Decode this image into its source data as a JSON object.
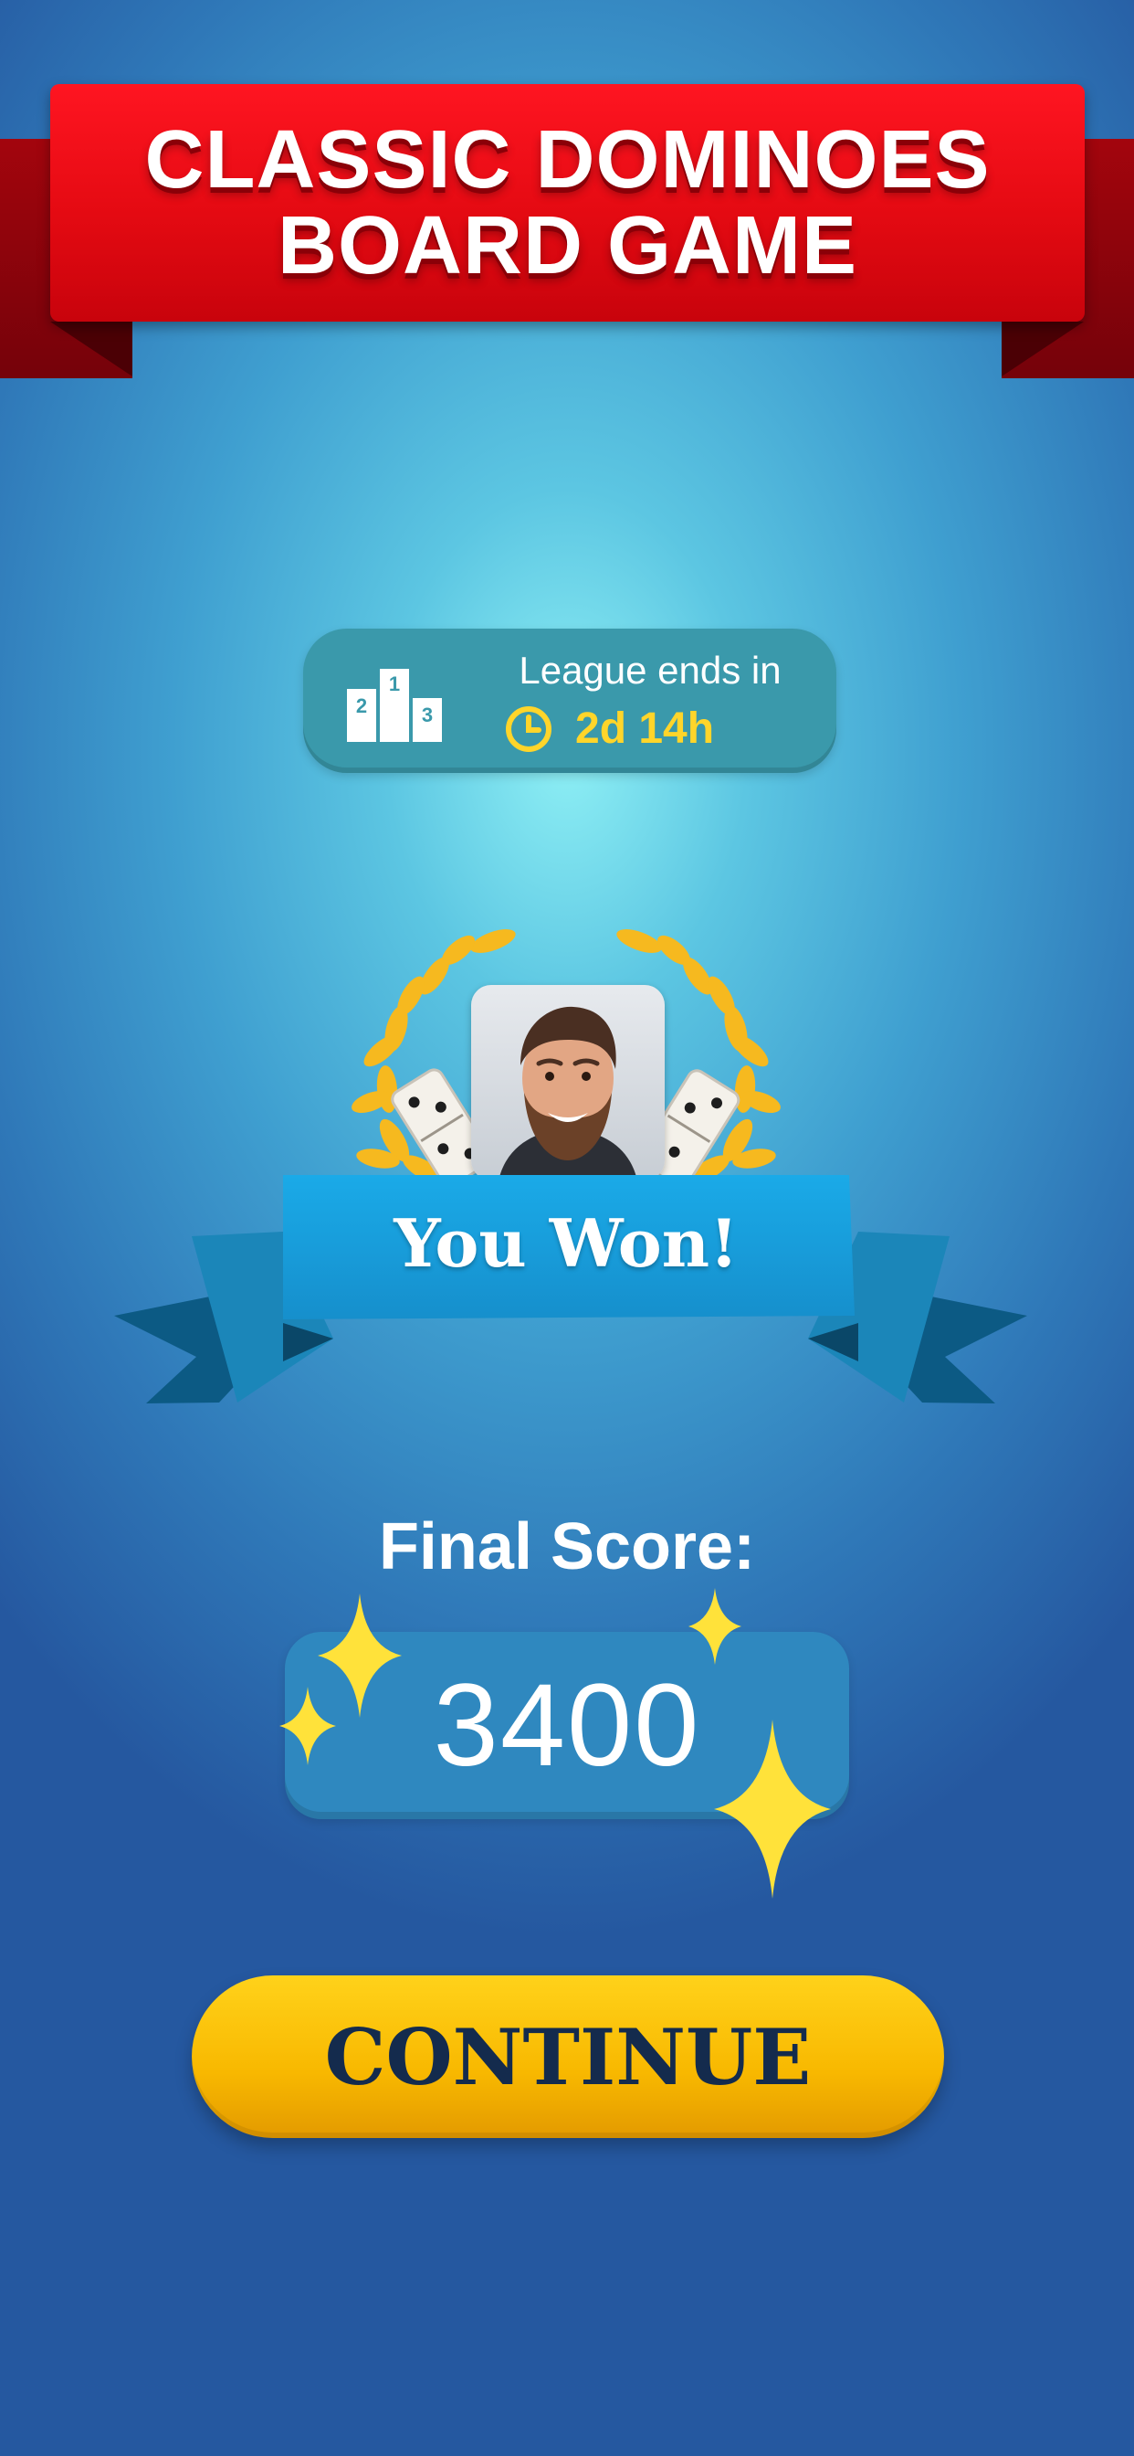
{
  "header": {
    "title_line1": "CLASSIC DOMINOES",
    "title_line2": "BOARD GAME"
  },
  "league": {
    "icon": "podium-icon",
    "podium_labels": [
      "2",
      "1",
      "3"
    ],
    "label": "League ends in",
    "time_icon": "clock-icon",
    "time_remaining": "2d 14h"
  },
  "result": {
    "avatar_icon": "player-avatar",
    "title": "You Won!"
  },
  "score": {
    "label": "Final Score:",
    "value": "3400"
  },
  "actions": {
    "continue_label": "CONTINUE"
  },
  "colors": {
    "banner_red": "#e40a12",
    "ribbon_blue": "#1a9ad6",
    "accent_yellow": "#ffd52a",
    "button_yellow": "#f8b800",
    "button_text": "#142b4d"
  }
}
